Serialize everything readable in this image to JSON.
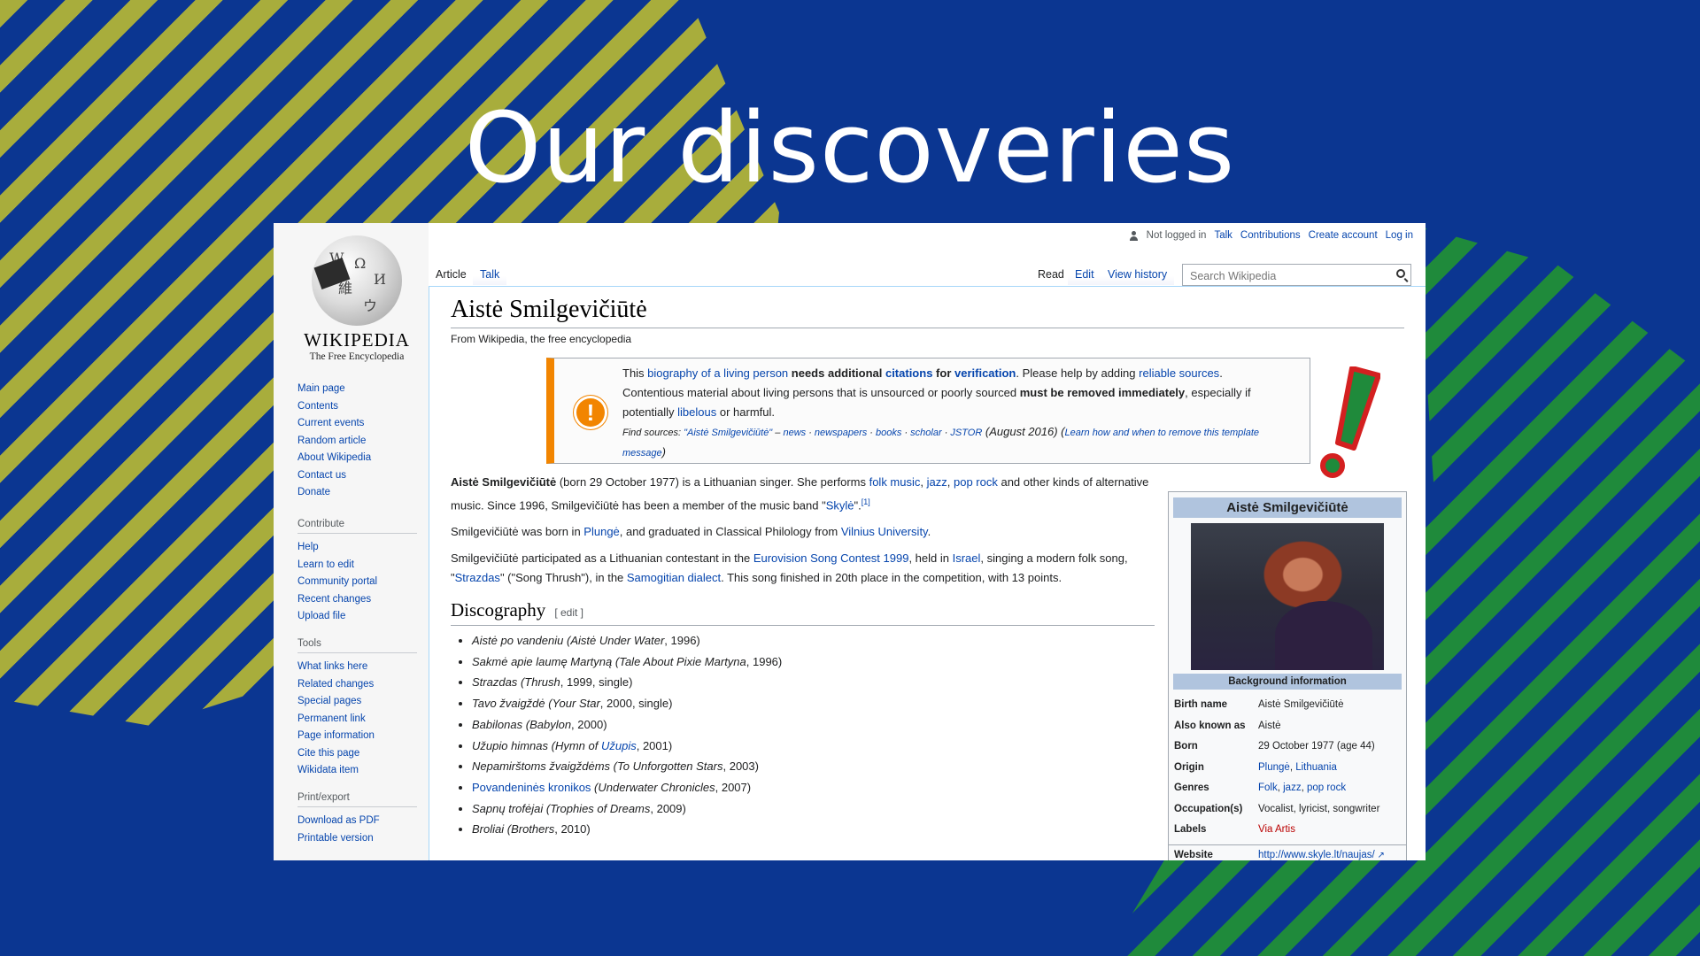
{
  "slide": {
    "title": "Our discoveries"
  },
  "logo": {
    "wordmark": "WIKIPEDIA",
    "tagline": "The Free Encyclopedia"
  },
  "personal": {
    "not_logged_in": "Not logged in",
    "links": [
      "Talk",
      "Contributions",
      "Create account",
      "Log in"
    ]
  },
  "tabs": {
    "article": "Article",
    "talk": "Talk",
    "read": "Read",
    "edit": "Edit",
    "history": "View history"
  },
  "search": {
    "placeholder": "Search Wikipedia"
  },
  "nav": {
    "main": [
      "Main page",
      "Contents",
      "Current events",
      "Random article",
      "About Wikipedia",
      "Contact us",
      "Donate"
    ],
    "contribute_header": "Contribute",
    "contribute": [
      "Help",
      "Learn to edit",
      "Community portal",
      "Recent changes",
      "Upload file"
    ],
    "tools_header": "Tools",
    "tools": [
      "What links here",
      "Related changes",
      "Special pages",
      "Permanent link",
      "Page information",
      "Cite this page",
      "Wikidata item"
    ],
    "print_header": "Print/export",
    "print": [
      "Download as PDF",
      "Printable version"
    ]
  },
  "article": {
    "title": "Aistė Smilgevičiūtė",
    "from": "From Wikipedia, the free encyclopedia",
    "notice": {
      "t1": "This ",
      "l1": "biography of a living person",
      "t2": " needs additional ",
      "l2": "citations",
      "t3": " for ",
      "l3": "verification",
      "t4": ". Please help by adding ",
      "l4": "reliable sources",
      "t5": ".",
      "t6": "Contentious material about living persons that is unsourced or poorly sourced ",
      "t7": "must be removed immediately",
      "t8": ", especially if potentially ",
      "l5": "libelous",
      "t9": " or harmful.",
      "find_label": "Find sources: ",
      "find_query": "\"Aistė Smilgevičiūtė\"",
      "find_dash": " – ",
      "find_links": [
        "news",
        "newspapers",
        "books",
        "scholar",
        "JSTOR"
      ],
      "find_date": " (August 2016) (",
      "find_learn": "Learn how and when to remove this template message",
      "find_close": ")"
    },
    "p1": {
      "bold": "Aistė Smilgevičiūtė",
      "t1": " (born 29 October 1977) is a Lithuanian singer. She performs ",
      "l1": "folk music",
      "c1": ", ",
      "l2": "jazz",
      "c2": ", ",
      "l3": "pop rock",
      "t2": " and other kinds of alternative music. Since 1996, Smilgevičiūtė has been a member of the music band \"",
      "l4": "Skylė",
      "t3": "\".",
      "ref": "[1]"
    },
    "p2": {
      "t1": "Smilgevičiūtė was born in ",
      "l1": "Plungė",
      "t2": ", and graduated in Classical Philology from ",
      "l2": "Vilnius University",
      "t3": "."
    },
    "p3": {
      "t1": "Smilgevičiūtė participated as a Lithuanian contestant in the ",
      "l1": "Eurovision Song Contest 1999",
      "t2": ", held in ",
      "l2": "Israel",
      "t3": ", singing a modern folk song, \"",
      "l3": "Strazdas",
      "t4": "\" (\"Song Thrush\"), in the ",
      "l4": "Samogitian dialect",
      "t5": ". This song finished in 20th place in the competition, with 13 points."
    },
    "disc_title": "Discography",
    "disc_edit": "[ edit ]",
    "discography": [
      {
        "pre": "",
        "title": "Aistė po vandeniu",
        "trans": "(Aistė Under Water",
        "rest": ", 1996)"
      },
      {
        "pre": "",
        "title": "Sakmė apie laumę Martyną",
        "trans": "(Tale About Pixie Martyna",
        "rest": ", 1996)"
      },
      {
        "pre": "",
        "title": "Strazdas",
        "trans": "(Thrush",
        "rest": ", 1999, single)"
      },
      {
        "pre": "",
        "title": "Tavo žvaigždė",
        "trans": "(Your Star",
        "rest": ", 2000, single)"
      },
      {
        "pre": "",
        "title": "Babilonas",
        "trans": "(Babylon",
        "rest": ", 2000)"
      },
      {
        "pre": "",
        "title": "Užupio himnas",
        "trans": "(Hymn of ",
        "link": "Užupis",
        "rest": ", 2001)"
      },
      {
        "pre": "",
        "title": "Nepamirštoms žvaigždėms",
        "trans": "(To Unforgotten Stars",
        "rest": ", 2003)"
      },
      {
        "pre": "Povandeninės kronikos",
        "title": "",
        "trans": "(Underwater Chronicles",
        "rest": ", 2007)"
      },
      {
        "pre": "",
        "title": "Sapnų trofėjai",
        "trans": "(Trophies of Dreams",
        "rest": ", 2009)"
      },
      {
        "pre": "",
        "title": "Broliai",
        "trans": "(Brothers",
        "rest": ", 2010)"
      }
    ]
  },
  "infobox": {
    "title": "Aistė Smilgevičiūtė",
    "subheader": "Background information",
    "rows": [
      {
        "k": "Birth name",
        "v": "Aistė Smilgevičiūtė"
      },
      {
        "k": "Also known as",
        "v": "Aistė"
      },
      {
        "k": "Born",
        "v": "29 October 1977 (age 44)"
      },
      {
        "k": "Origin",
        "v1": "Plungė",
        "sep": ", ",
        "v2": "Lithuania"
      },
      {
        "k": "Genres",
        "v1": "Folk",
        "v2": "jazz",
        "v3": "pop rock"
      },
      {
        "k": "Occupation(s)",
        "v": "Vocalist, lyricist, songwriter"
      },
      {
        "k": "Labels",
        "v": "Via Artis"
      },
      {
        "k": "Website",
        "v": "http://www.skyle.lt/naujas/"
      }
    ]
  },
  "colors": {
    "background": "#0b3691",
    "stripe_yellow": "#a8ad3c",
    "stripe_green": "#1f8a3b",
    "link": "#0645ad",
    "warning": "#f28500",
    "exclamation": "#d42020"
  }
}
